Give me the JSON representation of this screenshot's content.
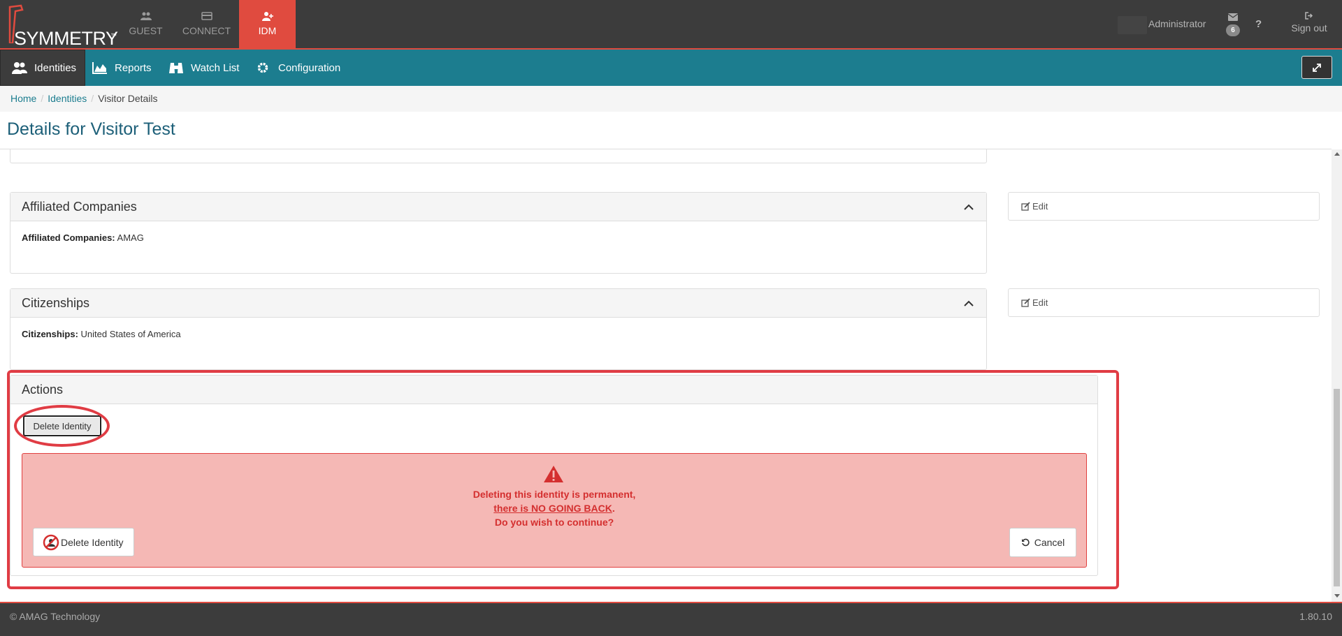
{
  "brand": {
    "name": "SYMMETRY",
    "tm": "™",
    "accent": "#e04b3f",
    "teal": "#1c7d8f"
  },
  "topnav": [
    {
      "label": "GUEST",
      "icon": "users-icon",
      "active": false
    },
    {
      "label": "CONNECT",
      "icon": "card-icon",
      "active": false
    },
    {
      "label": "IDM",
      "icon": "user-plus-icon",
      "active": true
    }
  ],
  "user": {
    "name": "Administrator",
    "messages_count": "6",
    "help": "?",
    "signout": "Sign out"
  },
  "subnav": {
    "identities": "Identities",
    "reports": "Reports",
    "watch_list": "Watch List",
    "configuration": "Configuration"
  },
  "breadcrumb": {
    "home": "Home",
    "identities": "Identities",
    "current": "Visitor Details",
    "sep": "/"
  },
  "page": {
    "title": "Details for Visitor Test"
  },
  "affiliated": {
    "heading": "Affiliated Companies",
    "field_label": "Affiliated Companies:",
    "field_value": "AMAG",
    "edit": "Edit"
  },
  "citizenships": {
    "heading": "Citizenships",
    "field_label": "Citizenships:",
    "field_value": "United States of America",
    "edit": "Edit"
  },
  "actions": {
    "heading": "Actions",
    "delete_button": "Delete Identity",
    "warning_line1": "Deleting this identity is permanent,",
    "warning_line2": "there is NO GOING BACK",
    "warning_line2_end": ".",
    "warning_line3": "Do you wish to continue?",
    "confirm_delete": "Delete Identity",
    "cancel": "Cancel"
  },
  "footer": {
    "copyright": "© AMAG Technology",
    "version": "1.80.10"
  }
}
